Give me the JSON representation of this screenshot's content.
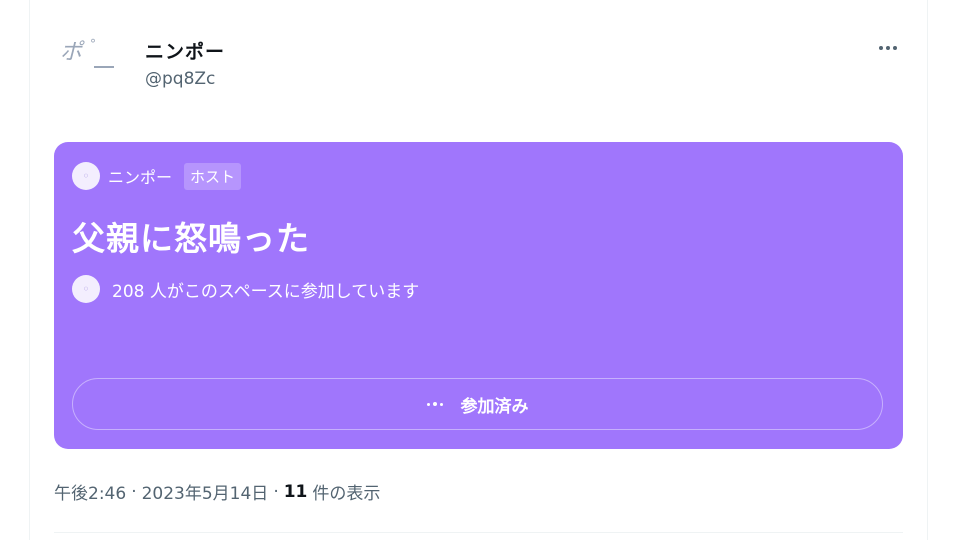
{
  "author": {
    "display_name": "ニンポー",
    "handle": "@pq8Zc",
    "avatar_text": "ポ"
  },
  "menu": {
    "more_icon": "more-horizontal-icon"
  },
  "space": {
    "background_color": "#a076fc",
    "host_name": "ニンポー",
    "host_badge": "ホスト",
    "title": "父親に怒鳴った",
    "listeners_text": "208 人がこのスペースに参加しています",
    "joined_button_label": "参加済み"
  },
  "meta": {
    "time": "午後2:46",
    "date": "2023年5月14日",
    "view_count": "11",
    "view_suffix": "件の表示",
    "separator": "·"
  }
}
